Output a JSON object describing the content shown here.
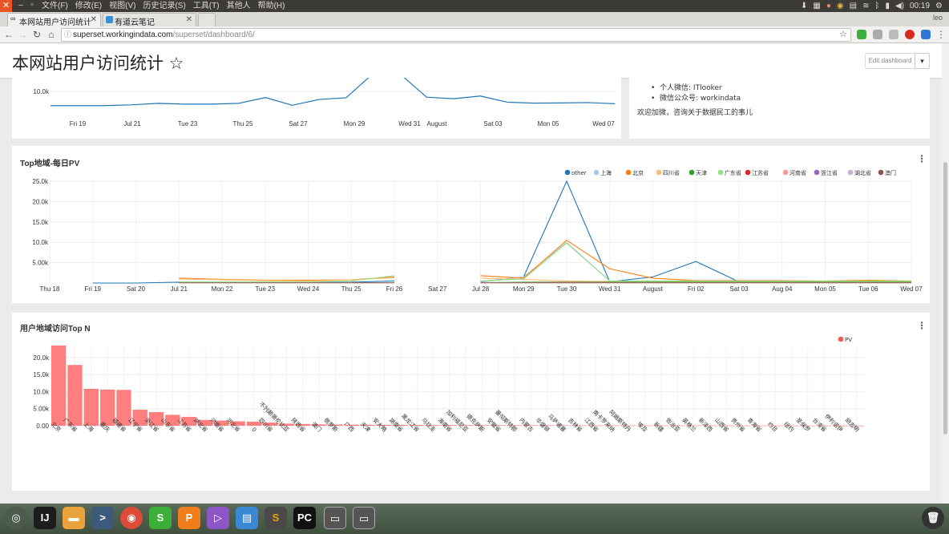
{
  "system_menu": [
    "文件(F)",
    "修改(E)",
    "视图(V)",
    "历史记录(S)",
    "工具(T)",
    "其他人",
    "帮助(H)"
  ],
  "system_clock": "00:19",
  "system_user": "leo",
  "tabs": [
    {
      "label": "本网站用户访问统计",
      "active": true
    },
    {
      "label": "有道云笔记",
      "active": false
    }
  ],
  "address": {
    "host": "superset.workingindata.com",
    "path": "/superset/dashboard/6/"
  },
  "dashboard": {
    "title": "本网站用户访问统计 ☆",
    "edit_label": "Edit dashboard",
    "dropdown_glyph": "▾"
  },
  "info_panel": {
    "lines": [
      "个人微信: ITlooker",
      "微信公众号: workindata"
    ],
    "footer": "欢迎加微，咨询关于数据民工的事儿"
  },
  "top_chart": {
    "y_ticks": [
      "10.0k"
    ],
    "x_ticks": [
      "Fri 19",
      "Jul 21",
      "Tue 23",
      "Thu 25",
      "Sat 27",
      "Mon 29",
      "Wed 31",
      "August",
      "Sat 03",
      "Mon 05",
      "Wed 07"
    ]
  },
  "chart_data": [
    {
      "type": "line",
      "title": "",
      "x_ticks": [
        "Fri 19",
        "Jul 21",
        "Tue 23",
        "Thu 25",
        "Sat 27",
        "Mon 29",
        "Wed 31",
        "August",
        "Sat 03",
        "Mon 05",
        "Wed 07"
      ],
      "y_ticks": [
        "10.0k"
      ],
      "series": [
        {
          "values": [
            2600,
            2600,
            2600,
            3000,
            3800,
            3400,
            3400,
            3800,
            6800,
            2800,
            5800,
            6700,
            30000,
            30000,
            7000,
            6200,
            7600,
            4400,
            3900,
            4000,
            4200,
            3600
          ]
        }
      ]
    },
    {
      "type": "line",
      "title": "Top地域-每日PV",
      "ylim": [
        0,
        25000
      ],
      "y_ticks": [
        "25.0k",
        "20.0k",
        "15.0k",
        "10.0k",
        "5.00k"
      ],
      "x_ticks": [
        "Thu 18",
        "Fri 19",
        "Sat 20",
        "Jul 21",
        "Mon 22",
        "Tue 23",
        "Wed 24",
        "Thu 25",
        "Fri 26",
        "Sat 27",
        "Jul 28",
        "Mon 29",
        "Tue 30",
        "Wed 31",
        "August",
        "Fri 02",
        "Sat 03",
        "Aug 04",
        "Mon 05",
        "Tue 06",
        "Wed 07"
      ],
      "legend": [
        "other",
        "上海",
        "北京",
        "四川省",
        "天津",
        "广东省",
        "江苏省",
        "河南省",
        "浙江省",
        "湖北省",
        "澳门"
      ],
      "series": [
        {
          "name": "other",
          "color": "#1f77b4",
          "values": [
            null,
            0,
            0,
            200,
            150,
            150,
            150,
            200,
            500,
            null,
            300,
            1500,
            25000,
            300,
            1500,
            5300,
            300,
            300,
            300,
            300,
            400
          ]
        },
        {
          "name": "上海",
          "color": "#aec7e8",
          "values": [
            null,
            null,
            null,
            null,
            null,
            null,
            null,
            null,
            null,
            null,
            200,
            1500,
            10000,
            500,
            500,
            500,
            500,
            500,
            400,
            300,
            400
          ]
        },
        {
          "name": "北京",
          "color": "#ff7f0e",
          "values": [
            null,
            null,
            null,
            1200,
            900,
            700,
            700,
            800,
            1500,
            null,
            1800,
            1200,
            10500,
            3500,
            1200,
            600,
            600,
            600,
            500,
            700,
            500
          ]
        },
        {
          "name": "四川省",
          "color": "#ffbb78",
          "values": [
            null,
            null,
            null,
            1000,
            800,
            600,
            500,
            800,
            1300,
            null,
            1200,
            900,
            500,
            400,
            300,
            300,
            300,
            300,
            300,
            300,
            300
          ]
        },
        {
          "name": "天津",
          "color": "#2ca02c",
          "values": [
            null,
            null,
            null,
            null,
            null,
            null,
            null,
            null,
            null,
            null,
            100,
            200,
            300,
            200,
            200,
            200,
            200,
            200,
            200,
            200,
            200
          ]
        },
        {
          "name": "广东省",
          "color": "#98df8a",
          "values": [
            null,
            null,
            null,
            300,
            300,
            300,
            300,
            500,
            1800,
            null,
            500,
            1000,
            9800,
            500,
            500,
            500,
            500,
            500,
            500,
            500,
            500
          ]
        },
        {
          "name": "江苏省",
          "color": "#d62728",
          "values": [
            null,
            null,
            null,
            100,
            100,
            100,
            100,
            100,
            100,
            null,
            100,
            100,
            100,
            100,
            100,
            100,
            100,
            100,
            100,
            100,
            100
          ]
        },
        {
          "name": "河南省",
          "color": "#ff9896",
          "values": [
            null,
            null,
            null,
            100,
            100,
            100,
            100,
            100,
            100,
            null,
            100,
            100,
            200,
            100,
            100,
            100,
            100,
            100,
            100,
            100,
            100
          ]
        },
        {
          "name": "浙江省",
          "color": "#9467bd",
          "values": [
            null,
            null,
            null,
            100,
            100,
            100,
            100,
            100,
            100,
            null,
            100,
            100,
            100,
            100,
            100,
            100,
            100,
            100,
            100,
            100,
            100
          ]
        },
        {
          "name": "湖北省",
          "color": "#c5b0d5",
          "values": [
            null,
            null,
            null,
            100,
            100,
            100,
            100,
            100,
            100,
            null,
            100,
            100,
            100,
            100,
            100,
            100,
            100,
            100,
            100,
            100,
            100
          ]
        },
        {
          "name": "澳门",
          "color": "#8c564b",
          "values": [
            null,
            null,
            null,
            50,
            50,
            50,
            50,
            50,
            50,
            null,
            50,
            50,
            50,
            50,
            50,
            50,
            50,
            50,
            50,
            50,
            50
          ]
        }
      ]
    },
    {
      "type": "bar",
      "title": "用户地域访问Top N",
      "ylim": [
        0,
        23000
      ],
      "y_ticks": [
        "20.0k",
        "15.0k",
        "10.0k",
        "5.00k",
        "0.00"
      ],
      "legend": [
        "PV"
      ],
      "color": "#ff7f7f",
      "categories": [
        "北京",
        "广东省",
        "上海",
        "重庆",
        "福建省",
        "辽宁省",
        "浙江省",
        "山东省",
        "江苏省",
        "湖北省",
        "河南省",
        "河北省",
        "0",
        "四川省",
        "不列颠哥伦比亚",
        "陕西省",
        "澳门",
        "俄罗斯",
        "广西",
        "天津",
        "安大略",
        "湖南省",
        "黑龙江省",
        "乌拉圭",
        "海南省",
        "加利福尼亚",
        "德克萨斯",
        "安徽省",
        "曼彻斯特郡",
        "内蒙古",
        "华盛顿",
        "马萨诸塞",
        "吉林省",
        "江西省",
        "南卡罗来纳",
        "阿姆斯特丹",
        "埃及",
        "新疆",
        "佐治亚",
        "英格兰",
        "新泽西",
        "山西省",
        "贵州省",
        "青海省",
        "约旦",
        "纽约",
        "圣保罗",
        "台湾省",
        "伊利诺伊",
        "胡志明"
      ],
      "values": [
        23500,
        17800,
        10800,
        10600,
        10500,
        4700,
        4000,
        3200,
        2600,
        1700,
        1500,
        1300,
        1200,
        900,
        600,
        500,
        400,
        350,
        300,
        280,
        250,
        230,
        210,
        200,
        190,
        180,
        170,
        160,
        150,
        140,
        130,
        120,
        110,
        100,
        95,
        90,
        85,
        80,
        75,
        70,
        65,
        60,
        55,
        50,
        45,
        40,
        35,
        30,
        25,
        20
      ]
    }
  ],
  "taskbar": {
    "apps": [
      "search-app",
      "intellij",
      "files",
      "terminal",
      "chrome",
      "slides",
      "presentation",
      "media-player",
      "file-manager",
      "sublime",
      "pycharm",
      "window-1",
      "window-2"
    ]
  }
}
